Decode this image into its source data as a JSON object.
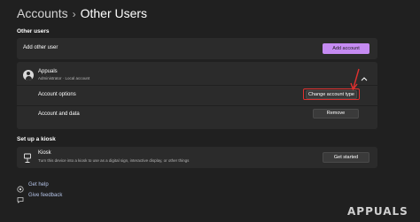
{
  "header": {
    "breadcrumb_root": "Accounts",
    "breadcrumb_separator": "›",
    "title": "Other Users"
  },
  "other_users": {
    "section_label": "Other users",
    "add_other_user_label": "Add other user",
    "add_account_button": "Add account",
    "user": {
      "name": "Appuals",
      "subtitle": "Administrator · Local account",
      "expanded": true
    },
    "account_options_label": "Account options",
    "change_account_type_button": "Change account type",
    "account_data_label": "Account and data",
    "remove_button": "Remove"
  },
  "kiosk": {
    "section_label": "Set up a kiosk",
    "title": "Kiosk",
    "description": "Turn this device into a kiosk to use as a digital sign, interactive display, or other things",
    "get_started_button": "Get started"
  },
  "footer": {
    "get_help": "Get help",
    "give_feedback": "Give feedback"
  },
  "watermark": "APPUALS",
  "colors": {
    "background": "#202020",
    "card": "#2b2b2b",
    "accent": "#c58bf2",
    "highlight": "#e0312f"
  },
  "icons": [
    "person-icon",
    "chevron-up-icon",
    "kiosk-icon",
    "help-icon",
    "feedback-icon",
    "annotation-arrow-icon"
  ]
}
